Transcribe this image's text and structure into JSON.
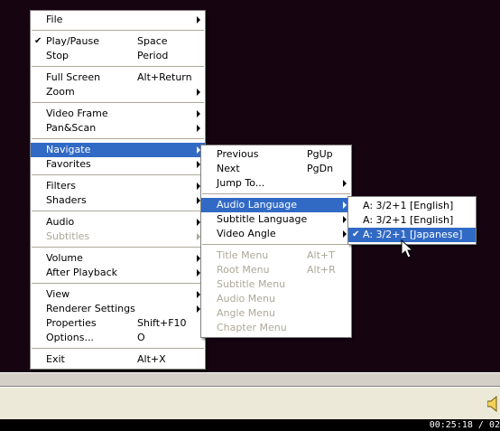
{
  "colors": {
    "video_bg": "#160411",
    "menu_bg": "#ffffff",
    "highlight": "#316ac5",
    "disabled_text": "#aca899"
  },
  "main_menu": [
    {
      "label": "File",
      "submenu": true
    },
    {
      "separator": true
    },
    {
      "label": "Play/Pause",
      "shortcut": "Space",
      "checked": true
    },
    {
      "label": "Stop",
      "shortcut": "Period"
    },
    {
      "separator": true
    },
    {
      "label": "Full Screen",
      "shortcut": "Alt+Return"
    },
    {
      "label": "Zoom",
      "submenu": true
    },
    {
      "separator": true
    },
    {
      "label": "Video Frame",
      "submenu": true
    },
    {
      "label": "Pan&Scan",
      "submenu": true
    },
    {
      "separator": true
    },
    {
      "label": "Navigate",
      "submenu": true,
      "highlighted": true
    },
    {
      "label": "Favorites",
      "submenu": true
    },
    {
      "separator": true
    },
    {
      "label": "Filters",
      "submenu": true
    },
    {
      "label": "Shaders",
      "submenu": true
    },
    {
      "separator": true
    },
    {
      "label": "Audio",
      "submenu": true
    },
    {
      "label": "Subtitles",
      "submenu": true,
      "disabled": true
    },
    {
      "separator": true
    },
    {
      "label": "Volume",
      "submenu": true
    },
    {
      "label": "After Playback",
      "submenu": true
    },
    {
      "separator": true
    },
    {
      "label": "View",
      "submenu": true
    },
    {
      "label": "Renderer Settings",
      "submenu": true
    },
    {
      "label": "Properties",
      "shortcut": "Shift+F10"
    },
    {
      "label": "Options...",
      "shortcut": "O"
    },
    {
      "separator": true
    },
    {
      "label": "Exit",
      "shortcut": "Alt+X"
    }
  ],
  "navigate_menu": [
    {
      "label": "Previous",
      "shortcut": "PgUp"
    },
    {
      "label": "Next",
      "shortcut": "PgDn"
    },
    {
      "label": "Jump To...",
      "submenu": true
    },
    {
      "separator": true
    },
    {
      "label": "Audio Language",
      "submenu": true,
      "highlighted": true
    },
    {
      "label": "Subtitle Language",
      "submenu": true
    },
    {
      "label": "Video Angle",
      "submenu": true
    },
    {
      "separator": true
    },
    {
      "label": "Title Menu",
      "shortcut": "Alt+T",
      "disabled": true
    },
    {
      "label": "Root Menu",
      "shortcut": "Alt+R",
      "disabled": true
    },
    {
      "label": "Subtitle Menu",
      "disabled": true
    },
    {
      "label": "Audio Menu",
      "disabled": true
    },
    {
      "label": "Angle Menu",
      "disabled": true
    },
    {
      "label": "Chapter Menu",
      "disabled": true
    }
  ],
  "audio_language_menu": [
    {
      "label": "A: 3/2+1 [English]"
    },
    {
      "label": "A: 3/2+1 [English]"
    },
    {
      "label": "A: 3/2+1 [Japanese]",
      "checked": true,
      "highlighted": true
    }
  ],
  "icons": {
    "check": "checkmark-icon",
    "submenu": "submenu-arrow-icon",
    "volume": "speaker-icon",
    "cursor": "mouse-pointer-icon"
  },
  "status": {
    "time": "00:25:18 / 02"
  }
}
